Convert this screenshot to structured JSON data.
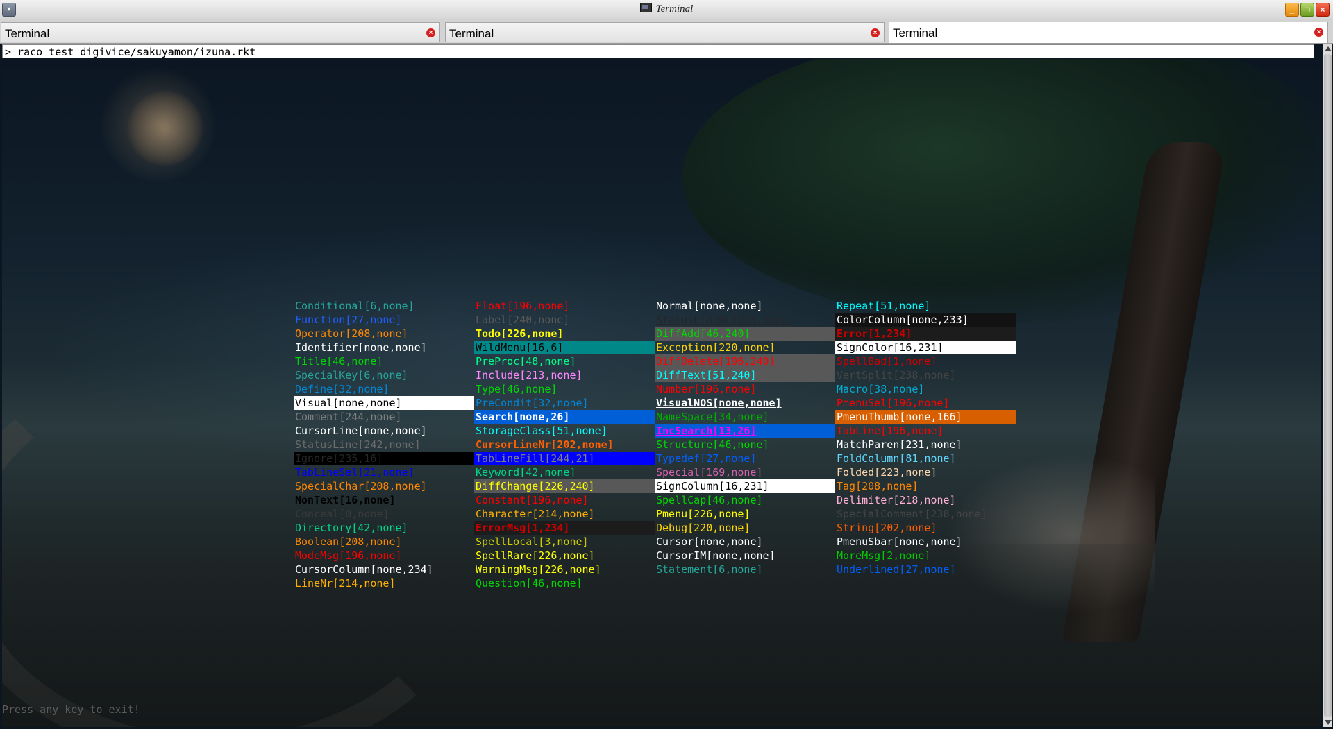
{
  "window": {
    "title": "Terminal"
  },
  "tabs": [
    {
      "label": "Terminal",
      "active": false
    },
    {
      "label": "Terminal",
      "active": false
    },
    {
      "label": "Terminal",
      "active": true
    }
  ],
  "command": "> raco test digivice/sakuyamon/izuna.rkt",
  "footer": "Press any key to exit!",
  "icons": {
    "menu": "menu-dropdown-icon",
    "app": "terminal-icon",
    "minimize": "minimize-icon",
    "maximize": "maximize-icon",
    "close": "close-icon",
    "tab_close": "tab-close-icon"
  },
  "grid": [
    [
      {
        "text": "Conditional[6,none]",
        "fg": "#26a69a"
      },
      {
        "text": "Function[27,none]",
        "fg": "#1e5fff"
      },
      {
        "text": "Operator[208,none]",
        "fg": "#ff8700"
      },
      {
        "text": "Identifier[none,none]",
        "fg": "#ffffff"
      },
      {
        "text": "Title[46,none]",
        "fg": "#00d700"
      },
      {
        "text": "SpecialKey[6,none]",
        "fg": "#26a69a"
      },
      {
        "text": "Define[32,none]",
        "fg": "#0087d7"
      },
      {
        "text": "Visual[none,none]",
        "fg": "#000000",
        "bg": "#ffffff"
      },
      {
        "text": "Comment[244,none]",
        "fg": "#808080"
      },
      {
        "text": "CursorLine[none,none]",
        "fg": "#ffffff"
      },
      {
        "text": "StatusLine[242,none]",
        "fg": "#6c6c6c",
        "u": true
      },
      {
        "text": "Ignore[235,16]",
        "fg": "#262626",
        "bg": "#000000"
      },
      {
        "text": "TabLineSel[21,none]",
        "fg": "#0000ff"
      },
      {
        "text": "SpecialChar[208,none]",
        "fg": "#ff8700"
      },
      {
        "text": "NonText[16,none]",
        "fg": "#000000",
        "b": true
      },
      {
        "text": "Conceal[0,none]",
        "fg": "#3a3a3a"
      },
      {
        "text": "Directory[42,none]",
        "fg": "#00d787"
      },
      {
        "text": "Boolean[208,none]",
        "fg": "#ff8700"
      },
      {
        "text": "ModeMsg[196,none]",
        "fg": "#ff0000"
      },
      {
        "text": "CursorColumn[none,234]",
        "fg": "#ffffff"
      },
      {
        "text": "LineNr[214,none]",
        "fg": "#ffaf00"
      }
    ],
    [
      {
        "text": "Float[196,none]",
        "fg": "#ff0000"
      },
      {
        "text": "Label[240,none]",
        "fg": "#585858"
      },
      {
        "text": "Todo[226,none]",
        "fg": "#ffff00",
        "b": true
      },
      {
        "text": "WildMenu[16,6]",
        "fg": "#000000",
        "bg": "#008787"
      },
      {
        "text": "PreProc[48,none]",
        "fg": "#00ff87"
      },
      {
        "text": "Include[213,none]",
        "fg": "#ff87ff"
      },
      {
        "text": "Type[46,none]",
        "fg": "#00d700"
      },
      {
        "text": "PreCondit[32,none]",
        "fg": "#0087d7"
      },
      {
        "text": "Search[none,26]",
        "fg": "#ffffff",
        "bg": "#005fd7",
        "b": true
      },
      {
        "text": "StorageClass[51,none]",
        "fg": "#00ffff"
      },
      {
        "text": "CursorLineNr[202,none]",
        "fg": "#ff5f00",
        "b": true
      },
      {
        "text": "TabLineFill[244,21]",
        "fg": "#808080",
        "bg": "#0000ff"
      },
      {
        "text": "Keyword[42,none]",
        "fg": "#00d787"
      },
      {
        "text": "DiffChange[226,240]",
        "fg": "#ffff00",
        "bg": "#585858"
      },
      {
        "text": "Constant[196,none]",
        "fg": "#ff0000"
      },
      {
        "text": "Character[214,none]",
        "fg": "#ffaf00"
      },
      {
        "text": "ErrorMsg[1,234]",
        "fg": "#cd0000",
        "bg": "#1c1c1c",
        "b": true
      },
      {
        "text": "SpellLocal[3,none]",
        "fg": "#cdcd00"
      },
      {
        "text": "SpellRare[226,none]",
        "fg": "#ffff00"
      },
      {
        "text": "WarningMsg[226,none]",
        "fg": "#ffff00"
      },
      {
        "text": "Question[46,none]",
        "fg": "#00d700"
      }
    ],
    [
      {
        "text": "Normal[none,none]",
        "fg": "#ffffff"
      },
      {
        "text": "StatusLineNC[235,none]",
        "fg": "#262626",
        "u": true
      },
      {
        "text": "DiffAdd[46,240]",
        "fg": "#00d700",
        "bg": "#585858"
      },
      {
        "text": "Exception[220,none]",
        "fg": "#ffd700"
      },
      {
        "text": "DiffDelete[196,240]",
        "fg": "#ff0000",
        "bg": "#585858"
      },
      {
        "text": "DiffText[51,240]",
        "fg": "#00ffff",
        "bg": "#585858"
      },
      {
        "text": "Number[196,none]",
        "fg": "#ff0000"
      },
      {
        "text": "VisualNOS[none,none]",
        "fg": "#ffffff",
        "b": true,
        "u": true
      },
      {
        "text": "NameSpace[34,none]",
        "fg": "#00af00"
      },
      {
        "text": "IncSearch[13,26]",
        "fg": "#ff00ff",
        "bg": "#005fd7",
        "b": true,
        "u": true
      },
      {
        "text": "Structure[46,none]",
        "fg": "#00d700"
      },
      {
        "text": "Typedef[27,none]",
        "fg": "#005fff"
      },
      {
        "text": "Special[169,none]",
        "fg": "#d75faf"
      },
      {
        "text": "SignColumn[16,231]",
        "fg": "#000000",
        "bg": "#ffffff"
      },
      {
        "text": "SpellCap[46,none]",
        "fg": "#00d700"
      },
      {
        "text": "Pmenu[226,none]",
        "fg": "#ffff00"
      },
      {
        "text": "Debug[220,none]",
        "fg": "#ffd700"
      },
      {
        "text": "Cursor[none,none]",
        "fg": "#ffffff"
      },
      {
        "text": "CursorIM[none,none]",
        "fg": "#ffffff"
      },
      {
        "text": "Statement[6,none]",
        "fg": "#26a69a"
      }
    ],
    [
      {
        "text": "Repeat[51,none]",
        "fg": "#00ffff"
      },
      {
        "text": "ColorColumn[none,233]",
        "fg": "#ffffff",
        "bg": "#121212"
      },
      {
        "text": "Error[1,234]",
        "fg": "#cd0000",
        "bg": "#1c1c1c",
        "b": true
      },
      {
        "text": "SignColor[16,231]",
        "fg": "#000000",
        "bg": "#ffffff"
      },
      {
        "text": "SpellBad[1,none]",
        "fg": "#cd0000"
      },
      {
        "text": "VertSplit[238,none]",
        "fg": "#444444"
      },
      {
        "text": "Macro[38,none]",
        "fg": "#00afd7"
      },
      {
        "text": "PmenuSel[196,none]",
        "fg": "#ff0000"
      },
      {
        "text": "PmenuThumb[none,166]",
        "fg": "#ffffff",
        "bg": "#d75f00"
      },
      {
        "text": "TabLine[196,none]",
        "fg": "#ff0000"
      },
      {
        "text": "MatchParen[231,none]",
        "fg": "#ffffff"
      },
      {
        "text": "FoldColumn[81,none]",
        "fg": "#5fd7ff"
      },
      {
        "text": "Folded[223,none]",
        "fg": "#ffd7af"
      },
      {
        "text": "Tag[208,none]",
        "fg": "#ff8700"
      },
      {
        "text": "Delimiter[218,none]",
        "fg": "#ffafd7"
      },
      {
        "text": "SpecialComment[238,none]",
        "fg": "#444444"
      },
      {
        "text": "String[202,none]",
        "fg": "#ff5f00"
      },
      {
        "text": "PmenuSbar[none,none]",
        "fg": "#ffffff"
      },
      {
        "text": "MoreMsg[2,none]",
        "fg": "#00cd00"
      },
      {
        "text": "Underlined[27,none]",
        "fg": "#005fff",
        "u": true
      }
    ]
  ]
}
